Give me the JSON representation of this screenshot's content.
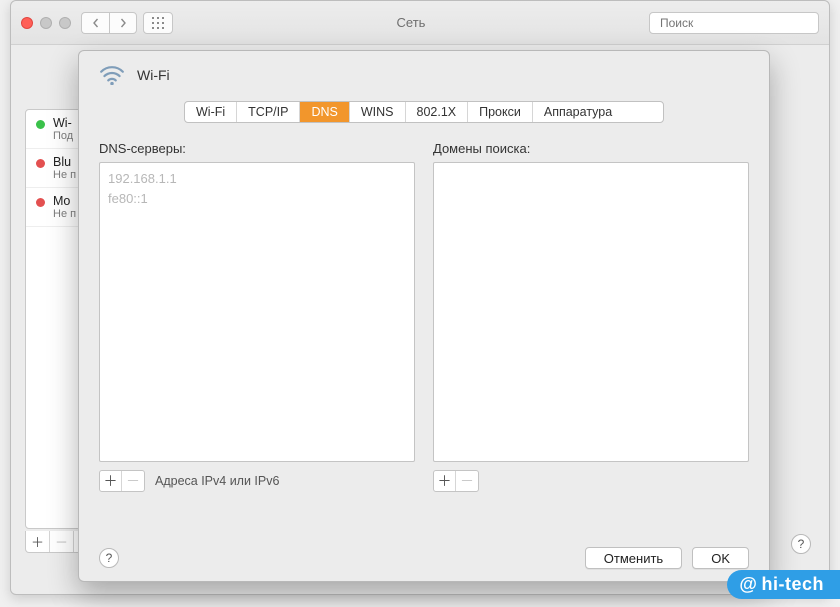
{
  "window": {
    "title": "Сеть",
    "search_placeholder": "Поиск"
  },
  "sidebar": {
    "items": [
      {
        "name": "Wi-",
        "sub": "Под",
        "status": "green"
      },
      {
        "name": "Blu",
        "sub": "Не п",
        "status": "red"
      },
      {
        "name": "Mo",
        "sub": "Не п",
        "status": "red"
      }
    ]
  },
  "sheet": {
    "title": "Wi-Fi",
    "tabs": [
      "Wi-Fi",
      "TCP/IP",
      "DNS",
      "WINS",
      "802.1X",
      "Прокси",
      "Аппаратура"
    ],
    "active_tab_index": 2,
    "dns": {
      "label": "DNS-серверы:",
      "entries": [
        "192.168.1.1",
        "fe80::1"
      ],
      "hint": "Адреса IPv4 или IPv6"
    },
    "search_domains": {
      "label": "Домены поиска:",
      "entries": []
    },
    "buttons": {
      "cancel": "Отменить",
      "ok": "OK"
    }
  },
  "watermark": "hi-tech"
}
